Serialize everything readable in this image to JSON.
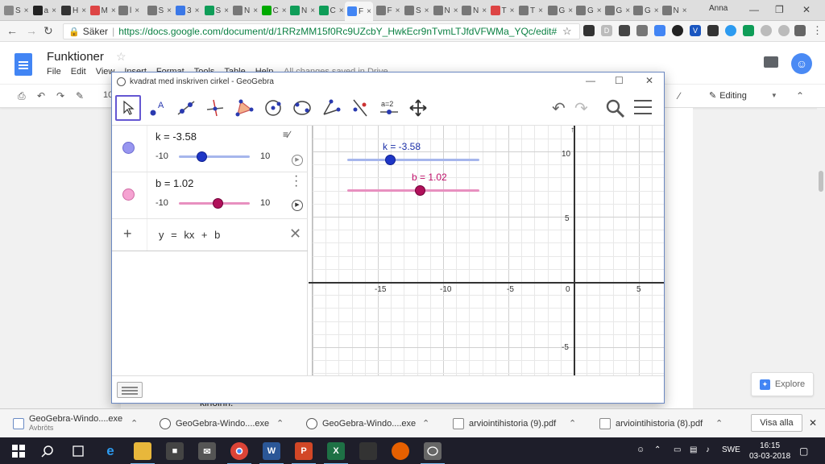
{
  "browser": {
    "tabs": [
      {
        "label": "S",
        "color": "#888"
      },
      {
        "label": "a",
        "color": "#222"
      },
      {
        "label": "H",
        "color": "#333"
      },
      {
        "label": "M",
        "color": "#d44"
      },
      {
        "label": "l",
        "color": "#777"
      },
      {
        "label": "S",
        "color": "#777"
      },
      {
        "label": "3",
        "color": "#3b78e7"
      },
      {
        "label": "S",
        "color": "#0f9d58"
      },
      {
        "label": "N",
        "color": "#777"
      },
      {
        "label": "C",
        "color": "#0a0"
      },
      {
        "label": "N",
        "color": "#0f9d58"
      },
      {
        "label": "C",
        "color": "#0f9d58"
      },
      {
        "label": "F",
        "color": "#4285f4"
      },
      {
        "label": "F",
        "color": "#777"
      },
      {
        "label": "S",
        "color": "#777"
      },
      {
        "label": "N",
        "color": "#777"
      },
      {
        "label": "N",
        "color": "#777"
      },
      {
        "label": "T",
        "color": "#d44"
      },
      {
        "label": "T",
        "color": "#777"
      },
      {
        "label": "G",
        "color": "#777"
      },
      {
        "label": "G",
        "color": "#777"
      },
      {
        "label": "G",
        "color": "#777"
      },
      {
        "label": "G",
        "color": "#777"
      },
      {
        "label": "N",
        "color": "#777"
      }
    ],
    "profile_name": "Anna",
    "secure_label": "Säker",
    "url": "https://docs.google.com/document/d/1RRzMM15f0Rc9UZcbY_HwkEcr9nTvmLTJfdVFWMa_YQc/edit#"
  },
  "docs": {
    "title": "Funktioner",
    "menu": [
      "File",
      "Edit",
      "View",
      "Insert",
      "Format",
      "Tools",
      "Table",
      "Help"
    ],
    "saved_status": "All changes saved in Drive",
    "zoom": "10",
    "mode": "Editing",
    "page_text": "kinoinn.",
    "explore_label": "Explore"
  },
  "geogebra": {
    "window_title": "kvadrat med inskriven cirkel - GeoGebra",
    "input_expression": "y = kx + b",
    "sliders": [
      {
        "label": "k = -3.58",
        "name": "k",
        "value": -3.58,
        "min": -10,
        "max": 10,
        "min_label": "-10",
        "max_label": "10",
        "color": "#9896f0",
        "track_color": "#a6b6ec",
        "knob_color": "#1e36c6"
      },
      {
        "label": "b = 1.02",
        "name": "b",
        "value": 1.02,
        "min": -10,
        "max": 10,
        "min_label": "-10",
        "max_label": "10",
        "color": "#f0a0d0",
        "track_color": "#e890c0",
        "knob_color": "#b0105a"
      }
    ],
    "axes": {
      "x_ticks": [
        "-15",
        "-10",
        "-5",
        "0",
        "5"
      ],
      "y_ticks": [
        "10",
        "5",
        "-5"
      ]
    },
    "graph_sliders": [
      {
        "label": "k = -3.58",
        "color": "#1a2ea8"
      },
      {
        "label": "b = 1.02",
        "color": "#c0106a"
      }
    ]
  },
  "downloads": {
    "items": [
      {
        "name": "GeoGebra-Windo....exe",
        "sub": "Avbröts"
      },
      {
        "name": "GeoGebra-Windo....exe",
        "sub": ""
      },
      {
        "name": "GeoGebra-Windo....exe",
        "sub": ""
      },
      {
        "name": "arviointihistoria (9).pdf",
        "sub": ""
      },
      {
        "name": "arviointihistoria (8).pdf",
        "sub": ""
      }
    ],
    "show_all": "Visa alla"
  },
  "taskbar": {
    "time": "16:15",
    "date": "03-03-2018",
    "lang": "SWE"
  }
}
